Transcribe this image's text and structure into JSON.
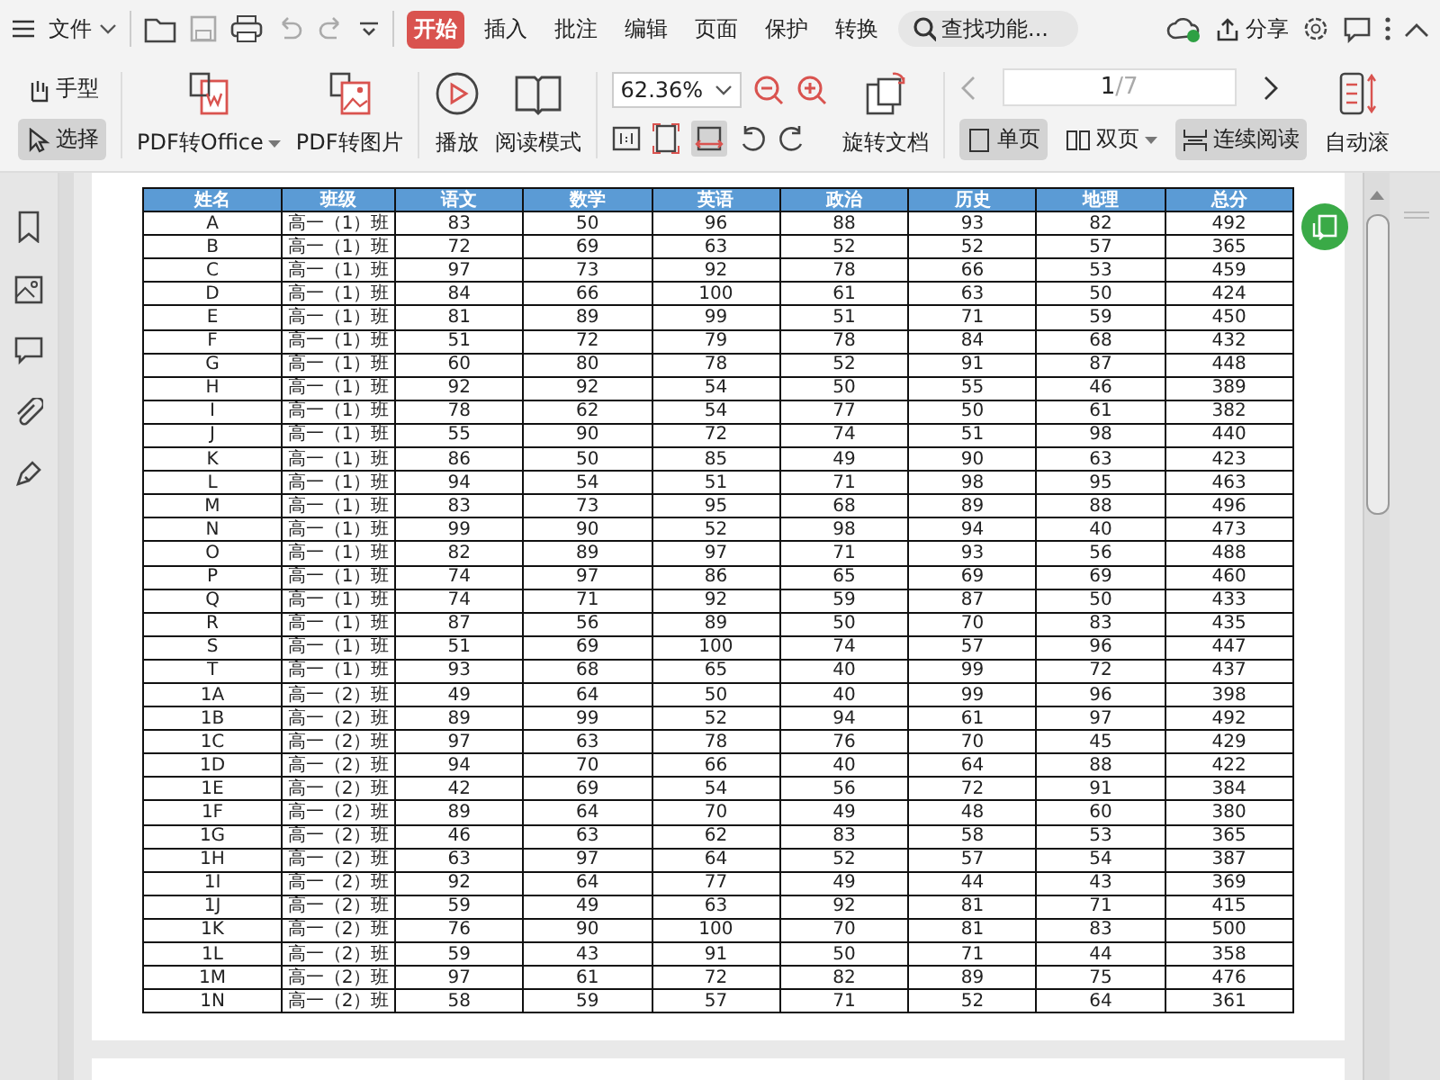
{
  "menu": {
    "label": "文件"
  },
  "tabs": [
    {
      "label": "开始",
      "selected": true
    },
    {
      "label": "插入",
      "selected": false
    },
    {
      "label": "批注",
      "selected": false
    },
    {
      "label": "编辑",
      "selected": false
    },
    {
      "label": "页面",
      "selected": false
    },
    {
      "label": "保护",
      "selected": false
    },
    {
      "label": "转换",
      "selected": false
    }
  ],
  "search": {
    "placeholder": "查找功能..."
  },
  "share": {
    "label": "分享"
  },
  "ribbon": {
    "hand": {
      "label": "手型",
      "selected": false
    },
    "select": {
      "label": "选择",
      "selected": true
    },
    "pdf_office": "PDF转Office",
    "pdf_image": "PDF转图片",
    "play": "播放",
    "read_mode": "阅读模式",
    "zoom": "62.36%",
    "rotate": "旋转文档",
    "page": "1",
    "page_total": "/7",
    "views": [
      {
        "label": "单页",
        "selected": true
      },
      {
        "label": "双页",
        "selected": false
      },
      {
        "label": "连续阅读",
        "selected": true
      }
    ],
    "auto_scroll": "自动滚"
  },
  "table": {
    "columns": [
      "姓名",
      "班级",
      "语文",
      "数学",
      "英语",
      "政治",
      "历史",
      "地理",
      "总分"
    ],
    "rows": [
      [
        "A",
        "高一（1）班",
        "83",
        "50",
        "96",
        "88",
        "93",
        "82",
        "492"
      ],
      [
        "B",
        "高一（1）班",
        "72",
        "69",
        "63",
        "52",
        "52",
        "57",
        "365"
      ],
      [
        "C",
        "高一（1）班",
        "97",
        "73",
        "92",
        "78",
        "66",
        "53",
        "459"
      ],
      [
        "D",
        "高一（1）班",
        "84",
        "66",
        "100",
        "61",
        "63",
        "50",
        "424"
      ],
      [
        "E",
        "高一（1）班",
        "81",
        "89",
        "99",
        "51",
        "71",
        "59",
        "450"
      ],
      [
        "F",
        "高一（1）班",
        "51",
        "72",
        "79",
        "78",
        "84",
        "68",
        "432"
      ],
      [
        "G",
        "高一（1）班",
        "60",
        "80",
        "78",
        "52",
        "91",
        "87",
        "448"
      ],
      [
        "H",
        "高一（1）班",
        "92",
        "92",
        "54",
        "50",
        "55",
        "46",
        "389"
      ],
      [
        "I",
        "高一（1）班",
        "78",
        "62",
        "54",
        "77",
        "50",
        "61",
        "382"
      ],
      [
        "J",
        "高一（1）班",
        "55",
        "90",
        "72",
        "74",
        "51",
        "98",
        "440"
      ],
      [
        "K",
        "高一（1）班",
        "86",
        "50",
        "85",
        "49",
        "90",
        "63",
        "423"
      ],
      [
        "L",
        "高一（1）班",
        "94",
        "54",
        "51",
        "71",
        "98",
        "95",
        "463"
      ],
      [
        "M",
        "高一（1）班",
        "83",
        "73",
        "95",
        "68",
        "89",
        "88",
        "496"
      ],
      [
        "N",
        "高一（1）班",
        "99",
        "90",
        "52",
        "98",
        "94",
        "40",
        "473"
      ],
      [
        "O",
        "高一（1）班",
        "82",
        "89",
        "97",
        "71",
        "93",
        "56",
        "488"
      ],
      [
        "P",
        "高一（1）班",
        "74",
        "97",
        "86",
        "65",
        "69",
        "69",
        "460"
      ],
      [
        "Q",
        "高一（1）班",
        "74",
        "71",
        "92",
        "59",
        "87",
        "50",
        "433"
      ],
      [
        "R",
        "高一（1）班",
        "87",
        "56",
        "89",
        "50",
        "70",
        "83",
        "435"
      ],
      [
        "S",
        "高一（1）班",
        "51",
        "69",
        "100",
        "74",
        "57",
        "96",
        "447"
      ],
      [
        "T",
        "高一（1）班",
        "93",
        "68",
        "65",
        "40",
        "99",
        "72",
        "437"
      ],
      [
        "1A",
        "高一（2）班",
        "49",
        "64",
        "50",
        "40",
        "99",
        "96",
        "398"
      ],
      [
        "1B",
        "高一（2）班",
        "89",
        "99",
        "52",
        "94",
        "61",
        "97",
        "492"
      ],
      [
        "1C",
        "高一（2）班",
        "97",
        "63",
        "78",
        "76",
        "70",
        "45",
        "429"
      ],
      [
        "1D",
        "高一（2）班",
        "94",
        "70",
        "66",
        "40",
        "64",
        "88",
        "422"
      ],
      [
        "1E",
        "高一（2）班",
        "42",
        "69",
        "54",
        "56",
        "72",
        "91",
        "384"
      ],
      [
        "1F",
        "高一（2）班",
        "89",
        "64",
        "70",
        "49",
        "48",
        "60",
        "380"
      ],
      [
        "1G",
        "高一（2）班",
        "46",
        "63",
        "62",
        "83",
        "58",
        "53",
        "365"
      ],
      [
        "1H",
        "高一（2）班",
        "63",
        "97",
        "64",
        "52",
        "57",
        "54",
        "387"
      ],
      [
        "1I",
        "高一（2）班",
        "92",
        "64",
        "77",
        "49",
        "44",
        "43",
        "369"
      ],
      [
        "1J",
        "高一（2）班",
        "59",
        "49",
        "63",
        "92",
        "81",
        "71",
        "415"
      ],
      [
        "1K",
        "高一（2）班",
        "76",
        "90",
        "100",
        "70",
        "81",
        "83",
        "500"
      ],
      [
        "1L",
        "高一（2）班",
        "59",
        "43",
        "91",
        "50",
        "71",
        "44",
        "358"
      ],
      [
        "1M",
        "高一（2）班",
        "97",
        "61",
        "72",
        "82",
        "89",
        "75",
        "476"
      ],
      [
        "1N",
        "高一（2）班",
        "58",
        "59",
        "57",
        "71",
        "52",
        "64",
        "361"
      ]
    ]
  }
}
